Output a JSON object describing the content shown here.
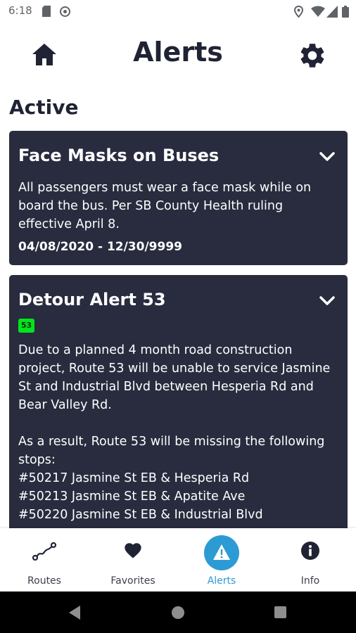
{
  "status_bar": {
    "time": "6:18"
  },
  "header": {
    "title": "Alerts"
  },
  "section": {
    "title": "Active"
  },
  "alerts": [
    {
      "title": "Face Masks on Buses",
      "body": "All passengers must wear a face mask while on board the bus. Per SB County Health ruling effective April 8.",
      "dates": "04/08/2020 - 12/30/9999"
    },
    {
      "title": "Detour Alert 53",
      "route_badge": "53",
      "body": "Due to a planned 4 month road construction project, Route 53 will be unable to service Jasmine St and Industrial Blvd between Hesperia Rd and Bear Valley Rd.\n\nAs a result, Route 53 will be missing the following stops:\n#50217 Jasmine St EB & Hesperia Rd\n#50213 Jasmine St EB & Apatite Ave\n#50220 Jasmine St EB & Industrial Blvd"
    }
  ],
  "bottom_nav": {
    "items": [
      {
        "label": "Routes",
        "icon": "route-icon"
      },
      {
        "label": "Favorites",
        "icon": "heart-icon"
      },
      {
        "label": "Alerts",
        "icon": "warning-icon",
        "active": true
      },
      {
        "label": "Info",
        "icon": "info-icon"
      }
    ]
  },
  "colors": {
    "accent": "#2d9bd3",
    "card": "#282c3e",
    "badge": "#00e51b",
    "text": "#1f2333"
  }
}
